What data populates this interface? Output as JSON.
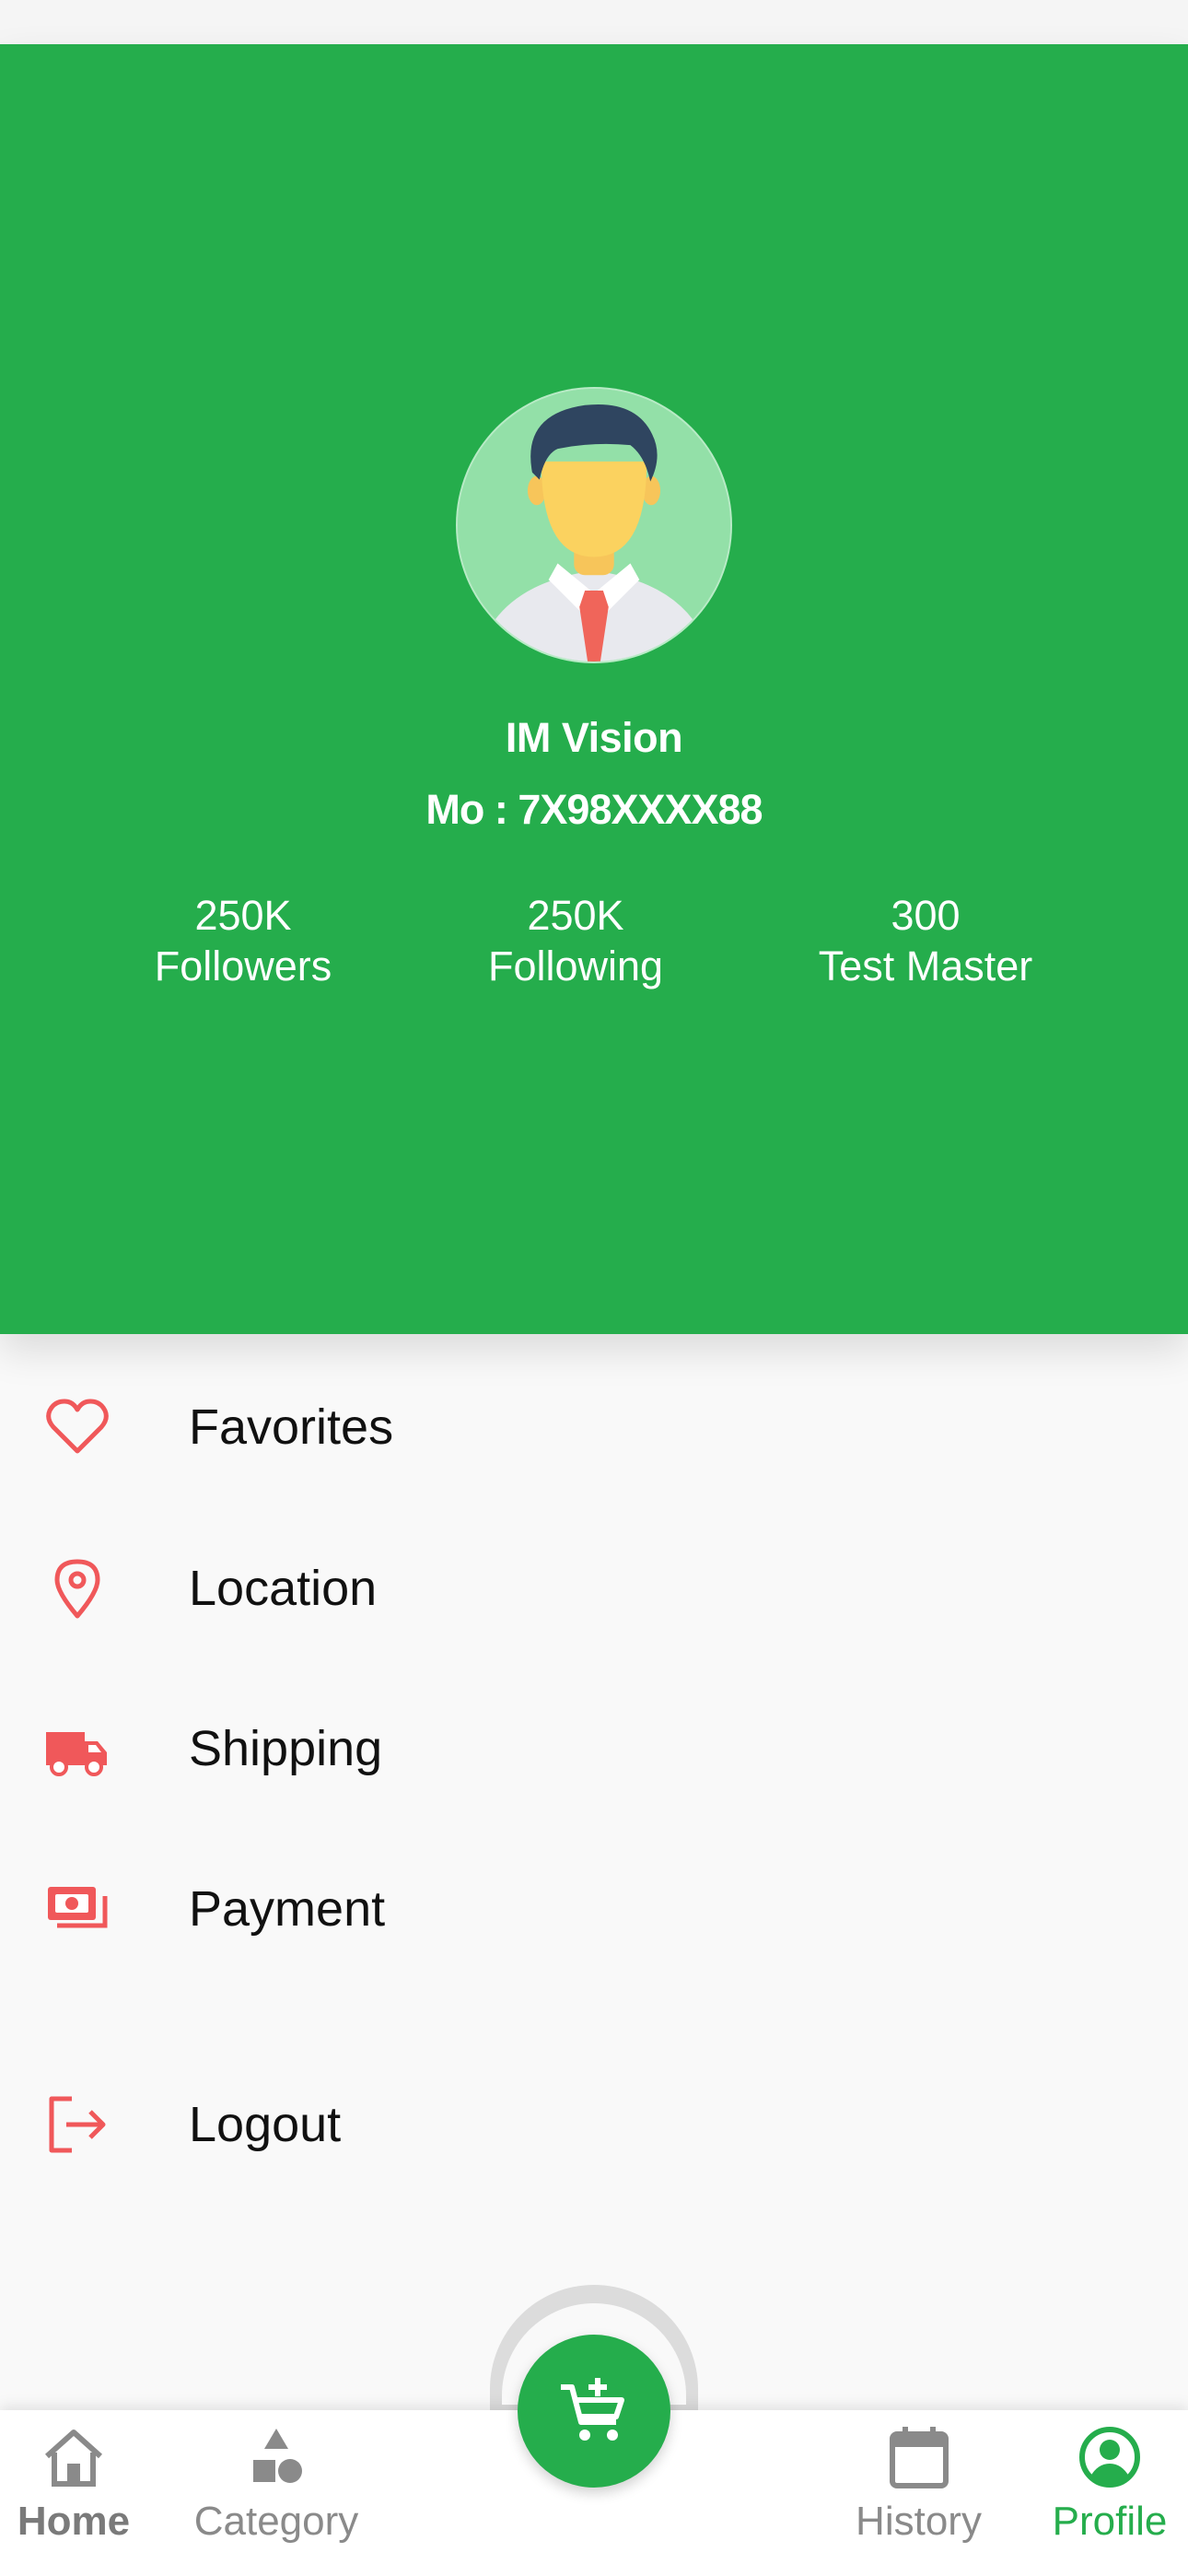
{
  "profile": {
    "name": "IM Vision",
    "phone": "Mo : 7X98XXXX88",
    "stats": [
      {
        "value": "250K",
        "label": "Followers"
      },
      {
        "value": "250K",
        "label": "Following"
      },
      {
        "value": "300",
        "label": "Test Master"
      }
    ]
  },
  "menu": {
    "items": [
      {
        "label": "Favorites",
        "icon": "heart-icon"
      },
      {
        "label": "Location",
        "icon": "location-pin-icon"
      },
      {
        "label": "Shipping",
        "icon": "truck-icon"
      },
      {
        "label": "Payment",
        "icon": "money-icon"
      },
      {
        "label": "Logout",
        "icon": "logout-icon"
      }
    ]
  },
  "bottom_nav": {
    "items": [
      {
        "label": "Home",
        "icon": "home-icon"
      },
      {
        "label": "Category",
        "icon": "shapes-icon"
      },
      {
        "label": "History",
        "icon": "calendar-icon"
      },
      {
        "label": "Profile",
        "icon": "user-circle-icon",
        "active": true
      }
    ],
    "fab_icon": "add-to-cart-icon"
  },
  "colors": {
    "brand_green": "#25ad4c",
    "menu_icon_red": "#f0585a",
    "nav_inactive": "#8a8a8a"
  }
}
